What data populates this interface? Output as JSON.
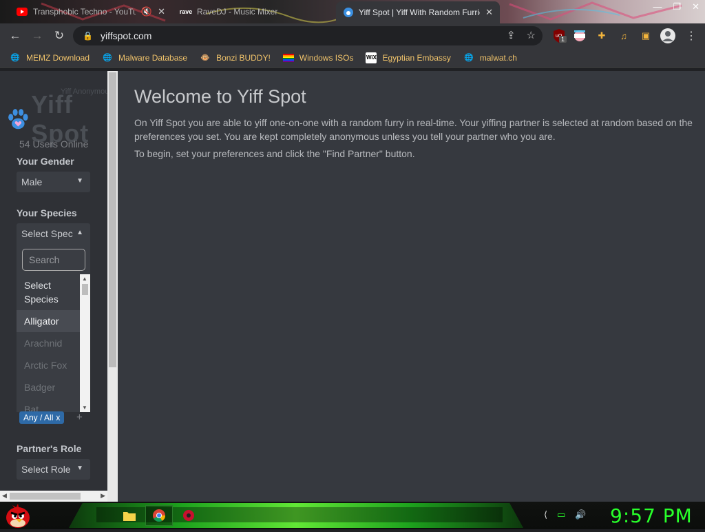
{
  "browser": {
    "tabs": [
      {
        "title": "Transphobic Techno - YouTube",
        "icon": "youtube-icon",
        "audio": "mute-icon"
      },
      {
        "title": "RaveDJ - Music Mixer",
        "icon": "ravedj-icon"
      },
      {
        "title": "Yiff Spot | Yiff With Random Furries",
        "icon": "yiffspot-icon",
        "active": true
      }
    ],
    "url": "yiffspot.com",
    "bookmarks": [
      {
        "label": "MEMZ Download",
        "icon": "globe-icon"
      },
      {
        "label": "Malware Database",
        "icon": "globe-icon"
      },
      {
        "label": "Bonzi BUDDY!",
        "icon": "bonzi-icon"
      },
      {
        "label": "Windows ISOs",
        "icon": "rainbow-flag-icon"
      },
      {
        "label": "Egyptian Embassy",
        "icon": "wix-icon"
      },
      {
        "label": "malwat.ch",
        "icon": "globe-icon"
      }
    ],
    "extensions": {
      "ublock_badge": "1"
    }
  },
  "sidebar": {
    "logo_text": "Yiff Spot",
    "logo_tagline": "Yiff Anonymous",
    "users_online": "54 Users Online",
    "gender_label": "Your Gender",
    "gender_value": "Male",
    "species_label": "Your Species",
    "species_value": "Select Spec",
    "search_placeholder": "Search",
    "species_options": [
      "Select Species",
      "Alligator",
      "Arachnid",
      "Arctic Fox",
      "Badger",
      "Bat"
    ],
    "highlighted_option": "Alligator",
    "chip_label": "Any / All",
    "chip_remove": "x",
    "chip_add": "+",
    "role_label": "Partner's Role",
    "role_value": "Select Role"
  },
  "main": {
    "heading": "Welcome to Yiff Spot",
    "paragraph1": "On Yiff Spot you are able to yiff one-on-one with a random furry in real-time. Your yiffing partner is selected at random based on the preferences you set. You are kept completely anonymous unless you tell your partner who you are.",
    "paragraph2": "To begin, set your preferences and click the \"Find Partner\" button."
  },
  "taskbar": {
    "clock": "9:57 PM",
    "apps": [
      "file-explorer-icon",
      "chrome-icon",
      "ravedj-app-icon"
    ],
    "accent_color": "#28ff2a"
  }
}
